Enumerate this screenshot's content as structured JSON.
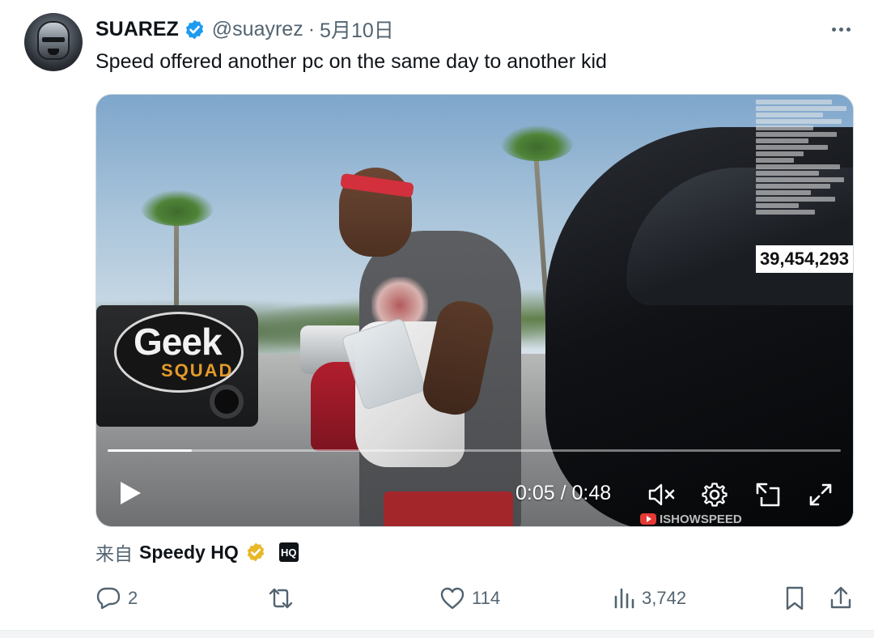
{
  "tweet": {
    "display_name": "SUAREZ",
    "handle": "@suayrez",
    "separator": "·",
    "date": "5月10日",
    "text": "Speed offered another pc on the same day to another kid"
  },
  "video": {
    "sign_top": "Geek",
    "sign_bottom": "SQUAD",
    "viewer_count": "39,454,293",
    "current_time": "0:05",
    "time_separator": "/",
    "duration": "0:48",
    "progress": 0.115,
    "watermark": "ISHOWSPEED"
  },
  "source": {
    "prefix": "来自",
    "name": "Speedy HQ",
    "logo_text": "HQ"
  },
  "actions": {
    "replies": "2",
    "likes": "114",
    "views": "3,742"
  },
  "colors": {
    "verified_blue": "#1d9bf0",
    "gold_badge": "#e8b829",
    "muted_text": "#536471"
  },
  "icons": {
    "more": "more-horizontal-icon",
    "reply": "reply-bubble-icon",
    "repost": "repost-arrows-icon",
    "like": "heart-icon",
    "views": "bar-chart-icon",
    "bookmark": "bookmark-icon",
    "share": "share-upload-icon"
  }
}
